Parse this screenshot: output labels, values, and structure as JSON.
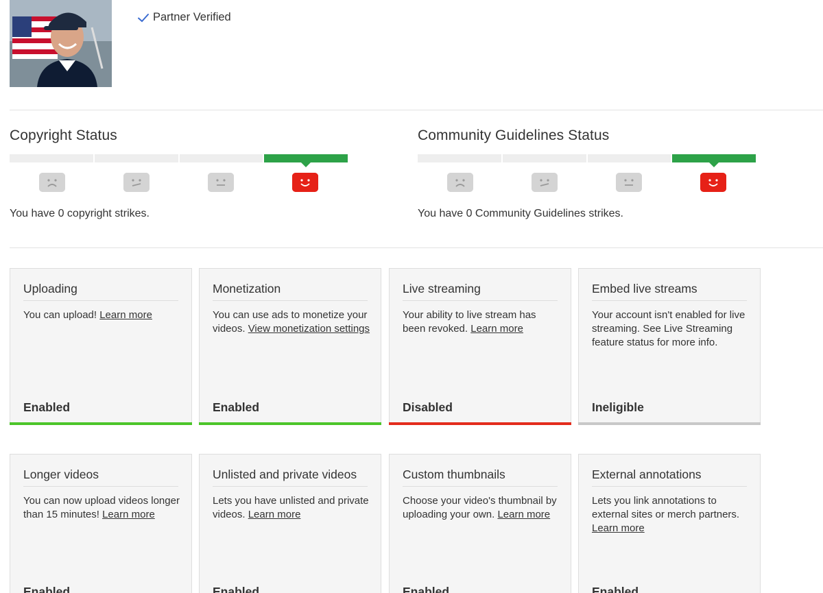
{
  "header": {
    "avatar_alt": "Channel avatar",
    "verified_label": "Partner Verified"
  },
  "copyright": {
    "title": "Copyright Status",
    "strikes_text": "You have 0 copyright strikes.",
    "active_segment": 4
  },
  "community": {
    "title": "Community Guidelines Status",
    "strikes_text": "You have 0 Community Guidelines strikes.",
    "active_segment": 4
  },
  "colors": {
    "enabled": "#4cc52a",
    "disabled": "#e32c1d",
    "ineligible": "#c8c8c8",
    "active_strike_bar": "#2da248",
    "face_active": "#e62117",
    "face_inactive": "#d4d4d4"
  },
  "cards": [
    {
      "title": "Uploading",
      "text": "You can upload! ",
      "link": "Learn more",
      "state": "Enabled"
    },
    {
      "title": "Monetization",
      "text": "You can use ads to monetize your videos. ",
      "link": "View monetization settings",
      "state": "Enabled"
    },
    {
      "title": "Live streaming",
      "text": "Your ability to live stream has been revoked. ",
      "link": "Learn more",
      "state": "Disabled"
    },
    {
      "title": "Embed live streams",
      "text": "Your account isn't enabled for live streaming. See Live Streaming feature status for more info.",
      "link": "",
      "state": "Ineligible"
    },
    {
      "title": "Longer videos",
      "text": "You can now upload videos longer than 15 minutes! ",
      "link": "Learn more",
      "state": "Enabled"
    },
    {
      "title": "Unlisted and private videos",
      "text": "Lets you have unlisted and private videos. ",
      "link": "Learn more",
      "state": "Enabled"
    },
    {
      "title": "Custom thumbnails",
      "text": "Choose your video's thumbnail by uploading your own. ",
      "link": "Learn more",
      "state": "Enabled"
    },
    {
      "title": "External annotations",
      "text": "Lets you link annotations to external sites or merch partners. ",
      "link": "Learn more",
      "state": "Enabled"
    }
  ]
}
